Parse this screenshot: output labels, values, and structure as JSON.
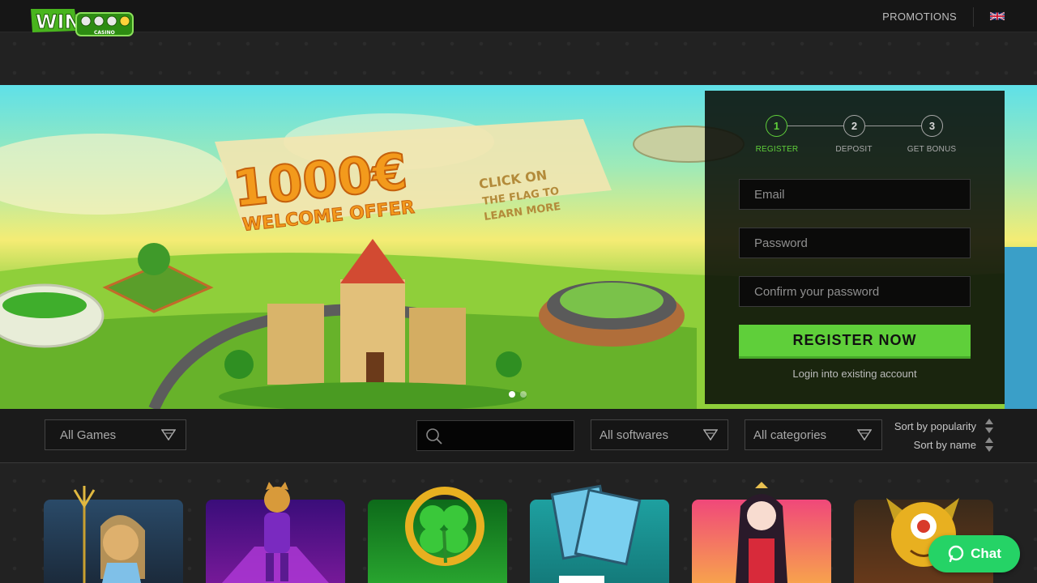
{
  "header": {
    "logo_text": "WIN",
    "logo_subtext": "CASINO",
    "promotions_label": "PROMOTIONS",
    "language": "English (UK flag)"
  },
  "hero": {
    "banner_amount": "1000€",
    "banner_offer": "WELCOME OFFER",
    "banner_cta_1": "CLICK ON",
    "banner_cta_2": "THE FLAG TO",
    "banner_cta_3": "LEARN MORE",
    "slides_total": 2,
    "active_slide": 1
  },
  "registration": {
    "steps": [
      {
        "number": "1",
        "label": "REGISTER",
        "active": true
      },
      {
        "number": "2",
        "label": "DEPOSIT",
        "active": false
      },
      {
        "number": "3",
        "label": "GET BONUS",
        "active": false
      }
    ],
    "email_placeholder": "Email",
    "password_placeholder": "Password",
    "confirm_placeholder": "Confirm your password",
    "register_button": "REGISTER NOW",
    "login_link": "Login into existing account"
  },
  "filters": {
    "games_select": "All Games",
    "search_placeholder": "",
    "softwares_select": "All softwares",
    "categories_select": "All categories",
    "sort_popularity": "Sort by popularity",
    "sort_name": "Sort by name"
  },
  "games": [
    {
      "name": "game-1",
      "theme": "water-goddess"
    },
    {
      "name": "game-2",
      "theme": "cat-casino"
    },
    {
      "name": "game-3",
      "theme": "lucky-clover"
    },
    {
      "name": "game-4",
      "theme": "bingo-cards"
    },
    {
      "name": "game-5",
      "theme": "anime-girl"
    },
    {
      "name": "game-6",
      "theme": "wild-monster"
    }
  ],
  "chat": {
    "label": "Chat"
  },
  "colors": {
    "accent_green": "#5fcf3a",
    "chat_green": "#25d366",
    "background": "#222222"
  }
}
